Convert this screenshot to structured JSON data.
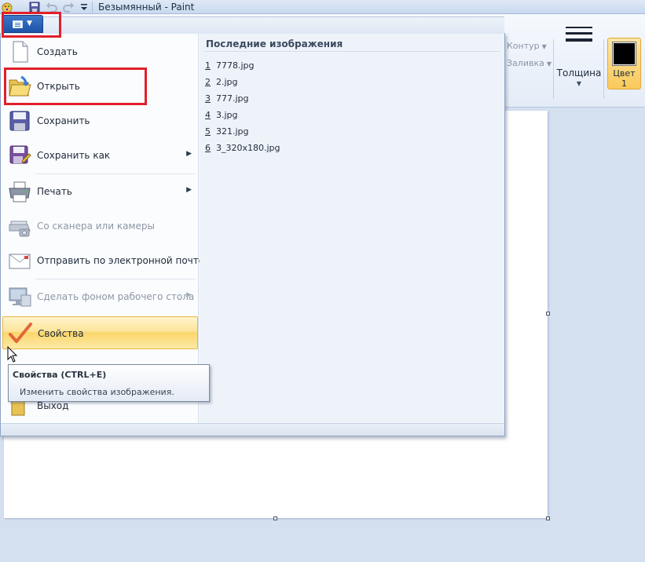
{
  "window": {
    "title": "Безымянный - Paint"
  },
  "ribbon": {
    "outline_label": "Контур",
    "fill_label": "Заливка",
    "thickness_label": "Толщина",
    "color1_label_line1": "Цвет",
    "color1_label_line2": "1",
    "color1_value": "#000000"
  },
  "menu": {
    "items": [
      {
        "label": "Создать",
        "icon": "new-file-icon",
        "enabled": true,
        "submenu": false
      },
      {
        "label": "Открыть",
        "icon": "open-folder-icon",
        "enabled": true,
        "submenu": false
      },
      {
        "label": "Сохранить",
        "icon": "save-icon",
        "enabled": true,
        "submenu": false
      },
      {
        "label": "Сохранить как",
        "icon": "save-as-icon",
        "enabled": true,
        "submenu": true
      },
      {
        "label": "Печать",
        "icon": "printer-icon",
        "enabled": true,
        "submenu": true
      },
      {
        "label": "Со сканера или камеры",
        "icon": "scanner-icon",
        "enabled": false,
        "submenu": false
      },
      {
        "label": "Отправить по электронной почте",
        "icon": "email-icon",
        "enabled": true,
        "submenu": false
      },
      {
        "label": "Сделать фоном рабочего стола",
        "icon": "desktop-background-icon",
        "enabled": false,
        "submenu": true
      },
      {
        "label": "Свойства",
        "icon": "checkmark-icon",
        "enabled": true,
        "submenu": false,
        "highlighted": true
      },
      {
        "label": "Выход",
        "icon": "exit-icon",
        "enabled": true,
        "submenu": false
      }
    ],
    "recent": {
      "title": "Последние изображения",
      "files": [
        {
          "num": "1",
          "name": "7778.jpg"
        },
        {
          "num": "2",
          "name": "2.jpg"
        },
        {
          "num": "3",
          "name": "777.jpg"
        },
        {
          "num": "4",
          "name": "3.jpg"
        },
        {
          "num": "5",
          "name": "321.jpg"
        },
        {
          "num": "6",
          "name": "3_320x180.jpg"
        }
      ]
    }
  },
  "tooltip": {
    "title": "Свойства (CTRL+E)",
    "description": "Изменить свойства изображения."
  },
  "colors": {
    "highlight_box": "#e0202a",
    "app_button": "#2a61b5"
  }
}
